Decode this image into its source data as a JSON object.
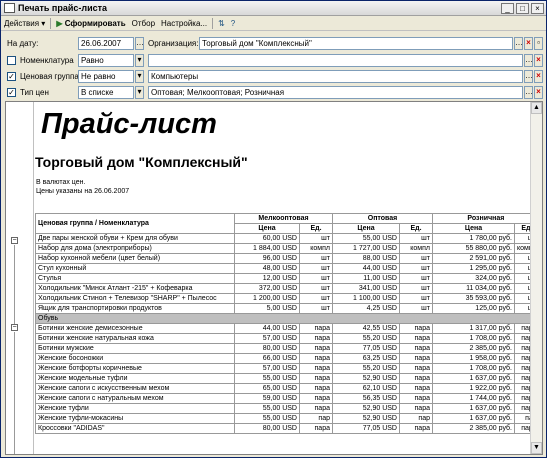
{
  "window": {
    "title": "Печать прайс-листа",
    "buttons": [
      "_",
      "□",
      "×"
    ]
  },
  "toolbar": {
    "actions": "Действия",
    "generate": "Сформировать",
    "select": "Отбор",
    "settings": "Настройка..."
  },
  "filters": {
    "date_label": "На дату:",
    "date_value": "26.06.2007",
    "org_label": "Организация:",
    "org_value": "Торговый дом \"Комплексный\"",
    "nom_label": "Номенклатура",
    "nom_cond": "Равно",
    "nom_value": "",
    "pg_label": "Ценовая группа",
    "pg_cond": "Не равно",
    "pg_value": "Компьютеры",
    "pt_label": "Тип цен",
    "pt_cond": "В списке",
    "pt_value": "Оптовая; Мелкооптовая; Розничная"
  },
  "report": {
    "title": "Прайс-лист",
    "firm": "Торговый дом \"Комплексный\"",
    "currency": "В валютах цен.",
    "date_note": "Цены указаны на 26.06.2007",
    "col_name": "Ценовая группа / Номенклатура",
    "col_groups": [
      "Мелкооптовая",
      "Оптовая",
      "Розничная"
    ],
    "sub_price": "Цена",
    "sub_unit": "Ед."
  },
  "rows": [
    {
      "type": "item",
      "name": "Две пары женской обуви + Крем для обуви",
      "p1": "60,00 USD",
      "u1": "шт",
      "p2": "55,00 USD",
      "u2": "шт",
      "p3": "1 780,00 руб.",
      "u3": "шт"
    },
    {
      "type": "item",
      "name": "Набор для дома (электроприборы)",
      "p1": "1 884,00 USD",
      "u1": "компл",
      "p2": "1 727,00 USD",
      "u2": "компл",
      "p3": "55 880,00 руб.",
      "u3": "компл"
    },
    {
      "type": "item",
      "name": "Набор кухонной мебели (цвет белый)",
      "p1": "96,00 USD",
      "u1": "шт",
      "p2": "88,00 USD",
      "u2": "шт",
      "p3": "2 591,00 руб.",
      "u3": "шт"
    },
    {
      "type": "item",
      "name": "Стул кухонный",
      "p1": "48,00 USD",
      "u1": "шт",
      "p2": "44,00 USD",
      "u2": "шт",
      "p3": "1 295,00 руб.",
      "u3": "шт"
    },
    {
      "type": "item",
      "name": "Стулья",
      "p1": "12,00 USD",
      "u1": "шт",
      "p2": "11,00 USD",
      "u2": "шт",
      "p3": "324,00 руб.",
      "u3": "шт"
    },
    {
      "type": "item",
      "name": "Холодильник \"Минск Атлант -215\" + Кофеварка",
      "p1": "372,00 USD",
      "u1": "шт",
      "p2": "341,00 USD",
      "u2": "шт",
      "p3": "11 034,00 руб.",
      "u3": "шт"
    },
    {
      "type": "item",
      "name": "Холодильник Стинол + Телевизор \"SHARP\" + Пылесос",
      "p1": "1 200,00 USD",
      "u1": "шт",
      "p2": "1 100,00 USD",
      "u2": "шт",
      "p3": "35 593,00 руб.",
      "u3": "шт"
    },
    {
      "type": "item",
      "name": "Ящик для транспортировки продуктов",
      "p1": "5,00 USD",
      "u1": "шт",
      "p2": "4,25 USD",
      "u2": "шт",
      "p3": "125,00 руб.",
      "u3": "шт"
    },
    {
      "type": "group",
      "name": "Обувь"
    },
    {
      "type": "item",
      "name": "Ботинки женские демисезонные",
      "p1": "44,00 USD",
      "u1": "пара",
      "p2": "42,55 USD",
      "u2": "пара",
      "p3": "1 317,00 руб.",
      "u3": "пара"
    },
    {
      "type": "item",
      "name": "Ботинки женские натуральная кожа",
      "p1": "57,00 USD",
      "u1": "пара",
      "p2": "55,20 USD",
      "u2": "пара",
      "p3": "1 708,00 руб.",
      "u3": "пара"
    },
    {
      "type": "item",
      "name": "Ботинки мужские",
      "p1": "80,00 USD",
      "u1": "пара",
      "p2": "77,05 USD",
      "u2": "пара",
      "p3": "2 385,00 руб.",
      "u3": "пара"
    },
    {
      "type": "item",
      "name": "Женские босоножки",
      "p1": "66,00 USD",
      "u1": "пара",
      "p2": "63,25 USD",
      "u2": "пара",
      "p3": "1 958,00 руб.",
      "u3": "пара"
    },
    {
      "type": "item",
      "name": "Женские ботфорты коричневые",
      "p1": "57,00 USD",
      "u1": "пара",
      "p2": "55,20 USD",
      "u2": "пара",
      "p3": "1 708,00 руб.",
      "u3": "пара"
    },
    {
      "type": "item",
      "name": "Женские модельные туфли",
      "p1": "55,00 USD",
      "u1": "пара",
      "p2": "52,90 USD",
      "u2": "пара",
      "p3": "1 637,00 руб.",
      "u3": "пара"
    },
    {
      "type": "item",
      "name": "Женские сапоги с искусственным мехом",
      "p1": "65,00 USD",
      "u1": "пара",
      "p2": "62,10 USD",
      "u2": "пара",
      "p3": "1 922,00 руб.",
      "u3": "пара"
    },
    {
      "type": "item",
      "name": "Женские сапоги с натуральным мехом",
      "p1": "59,00 USD",
      "u1": "пара",
      "p2": "56,35 USD",
      "u2": "пара",
      "p3": "1 744,00 руб.",
      "u3": "пара"
    },
    {
      "type": "item",
      "name": "Женские туфли",
      "p1": "55,00 USD",
      "u1": "пара",
      "p2": "52,90 USD",
      "u2": "пара",
      "p3": "1 637,00 руб.",
      "u3": "пара"
    },
    {
      "type": "item",
      "name": "Женские туфли-мокасины",
      "p1": "55,00 USD",
      "u1": "пар",
      "p2": "52,90 USD",
      "u2": "пар",
      "p3": "1 637,00 руб.",
      "u3": "пар"
    },
    {
      "type": "item",
      "name": "Кроссовки \"ADIDAS\"",
      "p1": "80,00 USD",
      "u1": "пара",
      "p2": "77,05 USD",
      "u2": "пара",
      "p3": "2 385,00 руб.",
      "u3": "пара"
    }
  ]
}
